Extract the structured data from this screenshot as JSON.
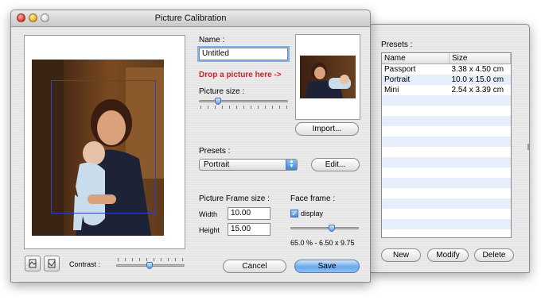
{
  "dialog": {
    "title": "Picture Calibration",
    "name_label": "Name :",
    "name_value": "Untitled",
    "drop_hint": "Drop a picture here ->",
    "picture_size_label": "Picture size :",
    "import_label": "Import...",
    "presets_label": "Presets :",
    "preset_selected": "Portrait",
    "edit_label": "Edit...",
    "frame_size_label": "Picture Frame size :",
    "width_label": "Width",
    "width_value": "10.00",
    "height_label": "Height",
    "height_value": "15.00",
    "face_frame_label": "Face frame :",
    "display_label": "display",
    "display_checked": true,
    "face_readout": "65.0 % - 6.50 x 9.75",
    "contrast_label": "Contrast :",
    "cancel_label": "Cancel",
    "save_label": "Save",
    "picture_size_level": 0.18,
    "face_frame_level": 0.6,
    "contrast_level": 0.5
  },
  "presets_panel": {
    "title": "Presets :",
    "columns": [
      "Name",
      "Size"
    ],
    "rows": [
      {
        "name": "Passport",
        "size": "3.38 x 4.50 cm"
      },
      {
        "name": "Portrait",
        "size": "10.0 x 15.0 cm"
      },
      {
        "name": "Mini",
        "size": "2.54 x 3.39 cm"
      }
    ],
    "new_label": "New",
    "modify_label": "Modify",
    "delete_label": "Delete"
  },
  "colors": {
    "accent": "#5b9be8",
    "drop_hint": "#c0282d",
    "row_stripe": "#e6eefb"
  }
}
